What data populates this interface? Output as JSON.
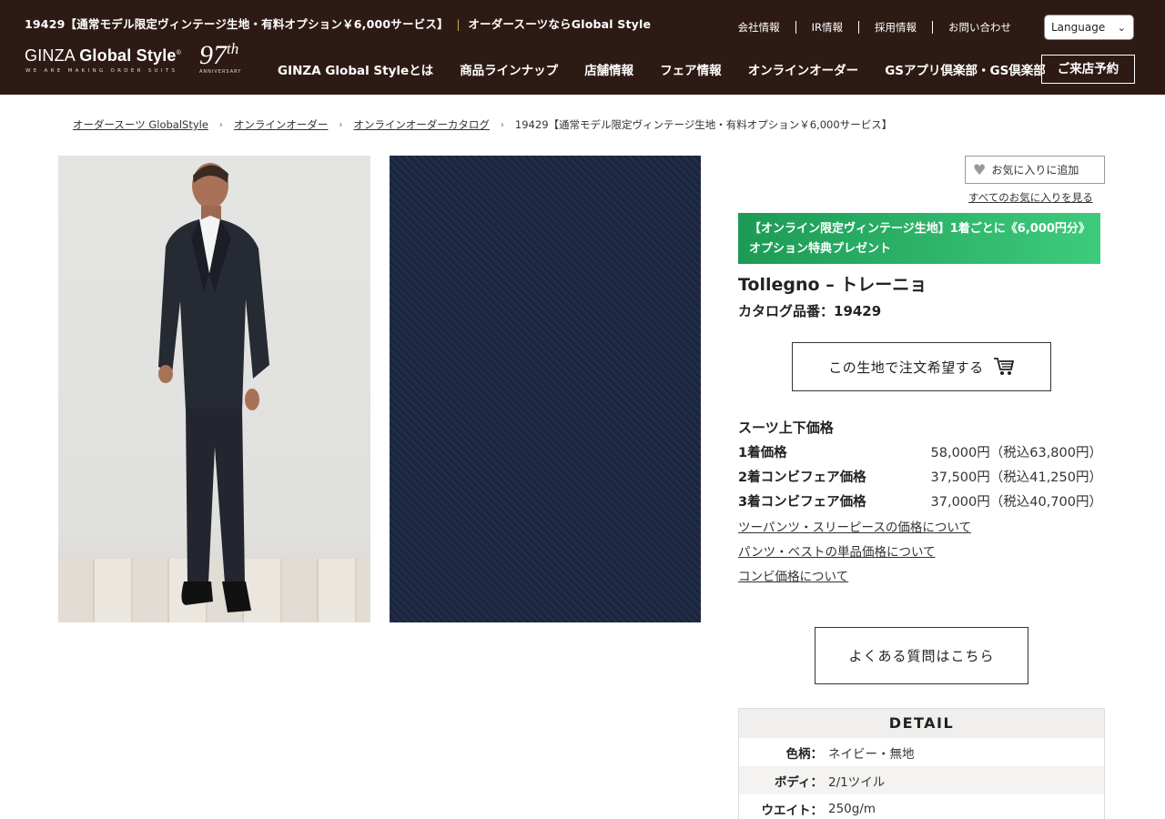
{
  "header": {
    "page_title": "19429【通常モデル限定ヴィンテージ生地・有料オプション￥6,000サービス】",
    "separator": "|",
    "tagline": "オーダースーツならGlobal Style",
    "utility_links": [
      "会社情報",
      "IR情報",
      "採用情報",
      "お問い合わせ"
    ],
    "language_label": "Language",
    "logo": {
      "brand_light": "GINZA",
      "brand_bold": "Global Style",
      "registered": "®",
      "slogan": "WE ARE MAKING ORDER SUITS",
      "anniversary_num": "97",
      "anniversary_suffix": "th",
      "anniversary_label": "ANNIVERSARY"
    },
    "nav": [
      "GINZA Global Styleとは",
      "商品ラインナップ",
      "店舗情報",
      "フェア情報",
      "オンラインオーダー",
      "GSアプリ倶楽部・GS倶楽部"
    ],
    "visit_button": "ご来店予約"
  },
  "breadcrumb": {
    "items": [
      "オーダースーツ GlobalStyle",
      "オンラインオーダー",
      "オンラインオーダーカタログ"
    ],
    "separator": "›",
    "current": "19429【通常モデル限定ヴィンテージ生地・有料オプション￥6,000サービス】"
  },
  "product": {
    "favorite_label": "お気に入りに追加",
    "all_favorites_link": "すべてのお気に入りを見る",
    "promo_text": "【オンライン限定ヴィンテージ生地】1着ごとに《6,000円分》オプション特典プレゼント",
    "name": "Tollegno – トレーニョ",
    "catalog_no": "カタログ品番：19429",
    "order_button": "この生地で注文希望する",
    "price_heading": "スーツ上下価格",
    "prices": [
      {
        "label": "1着価格",
        "value": "58,000円（税込63,800円）"
      },
      {
        "label": "2着コンビフェア価格",
        "value": "37,500円（税込41,250円）"
      },
      {
        "label": "3着コンビフェア価格",
        "value": "37,000円（税込40,700円）"
      }
    ],
    "price_links": [
      "ツーパンツ・スリーピースの価格について",
      "パンツ・ベストの単品価格について",
      "コンビ価格について"
    ],
    "faq_button": "よくある質問はこちら",
    "detail": {
      "heading": "DETAIL",
      "rows": [
        {
          "key": "色柄：",
          "value": "ネイビー・無地"
        },
        {
          "key": "ボディ：",
          "value": "2/1ツイル"
        },
        {
          "key": "ウエイト：",
          "value": "250g/m"
        }
      ]
    }
  },
  "colors": {
    "header_bg": "#2e1a15",
    "promo_green": "#2bb36a",
    "fabric_navy": "#1f2a44"
  }
}
